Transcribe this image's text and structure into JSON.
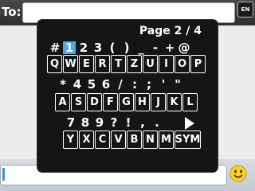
{
  "composer": {
    "to_label": "To:",
    "language": "EN"
  },
  "keyboard": {
    "page_indicator": "Page 2 / 4",
    "symbol_rows": [
      [
        "#",
        "1",
        "2",
        "3",
        "(",
        ")",
        "_",
        "-",
        "+",
        "@"
      ],
      [
        "*",
        "4",
        "5",
        "6",
        "/",
        ":",
        ";",
        "'",
        "\""
      ],
      [
        "7",
        "8",
        "9",
        "?",
        "!",
        ",",
        "."
      ]
    ],
    "selected_symbol": "1",
    "key_rows": [
      [
        "Q",
        "W",
        "E",
        "R",
        "T",
        "Z",
        "U",
        "I",
        "O",
        "P"
      ],
      [
        "A",
        "S",
        "D",
        "F",
        "G",
        "H",
        "J",
        "K",
        "L"
      ],
      [
        "Y",
        "X",
        "C",
        "V",
        "B",
        "N",
        "M",
        "SYM"
      ]
    ]
  },
  "colors": {
    "selection": "#4aa7f0",
    "popup_bg": "#151515"
  },
  "icons": {
    "next_page": "arrow-right-icon",
    "emoticon": "smiley-icon"
  }
}
